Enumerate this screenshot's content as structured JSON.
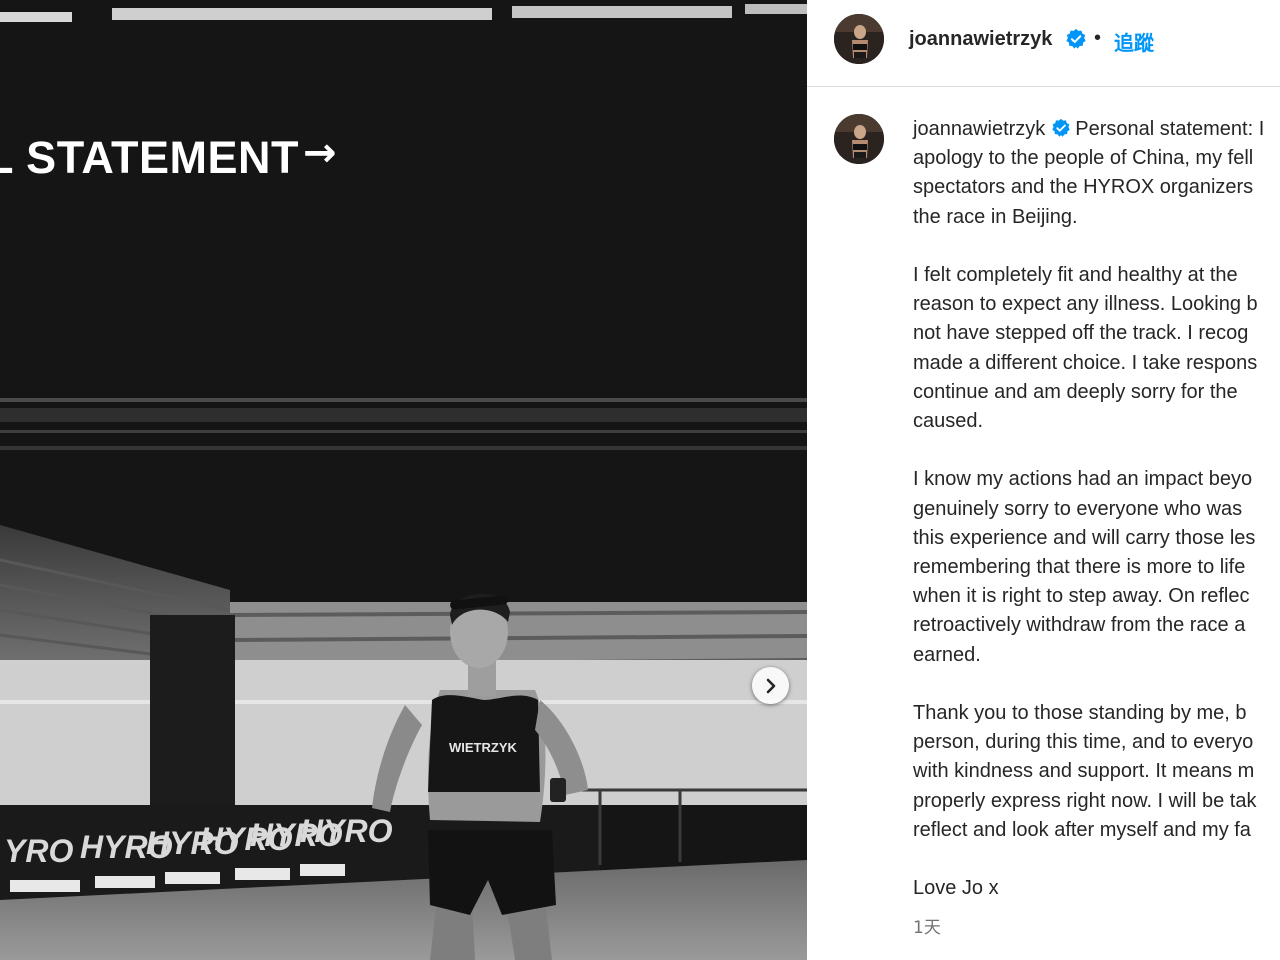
{
  "media": {
    "overlay_text": "L STATEMENT",
    "arrow_glyph": "→",
    "next_icon": "chevron-right-icon",
    "jersey_text": "WIETRZYK",
    "barrier_text": [
      "YRO",
      "HYRO",
      "HYRO",
      "HYRO",
      "HYRO",
      "HYRO"
    ]
  },
  "post": {
    "username": "joannawietrzyk",
    "verified_icon": "verified-badge-icon",
    "separator": "•",
    "follow_label": "追蹤",
    "caption_lines": [
      "Personal statement: I",
      "apology to the people of China, my fell",
      "spectators and the HYROX organizers",
      "the race in Beijing.",
      "I felt completely fit and healthy at the",
      "reason to expect any illness. Looking b",
      "not have stepped off the track. I recog",
      "made a different choice. I take respons",
      "continue and am deeply sorry for the",
      "caused.",
      "I know my actions had an impact beyo",
      "genuinely sorry to everyone who was",
      "this experience and will carry those les",
      "remembering that there is more to life",
      "when it is right to step away. On reflec",
      "retroactively withdraw from the race a",
      "earned.",
      "Thank you to those standing by me, b",
      "person, during this time, and to everyo",
      "with kindness and support. It means m",
      "properly express right now. I will be tak",
      "reflect and look after myself and my fa",
      "Love Jo x"
    ],
    "timestamp": "1天"
  },
  "colors": {
    "link_blue": "#0095f6",
    "verified_blue": "#0095f6",
    "text": "#262626",
    "muted": "#737373",
    "divider": "#dbdbdb"
  }
}
